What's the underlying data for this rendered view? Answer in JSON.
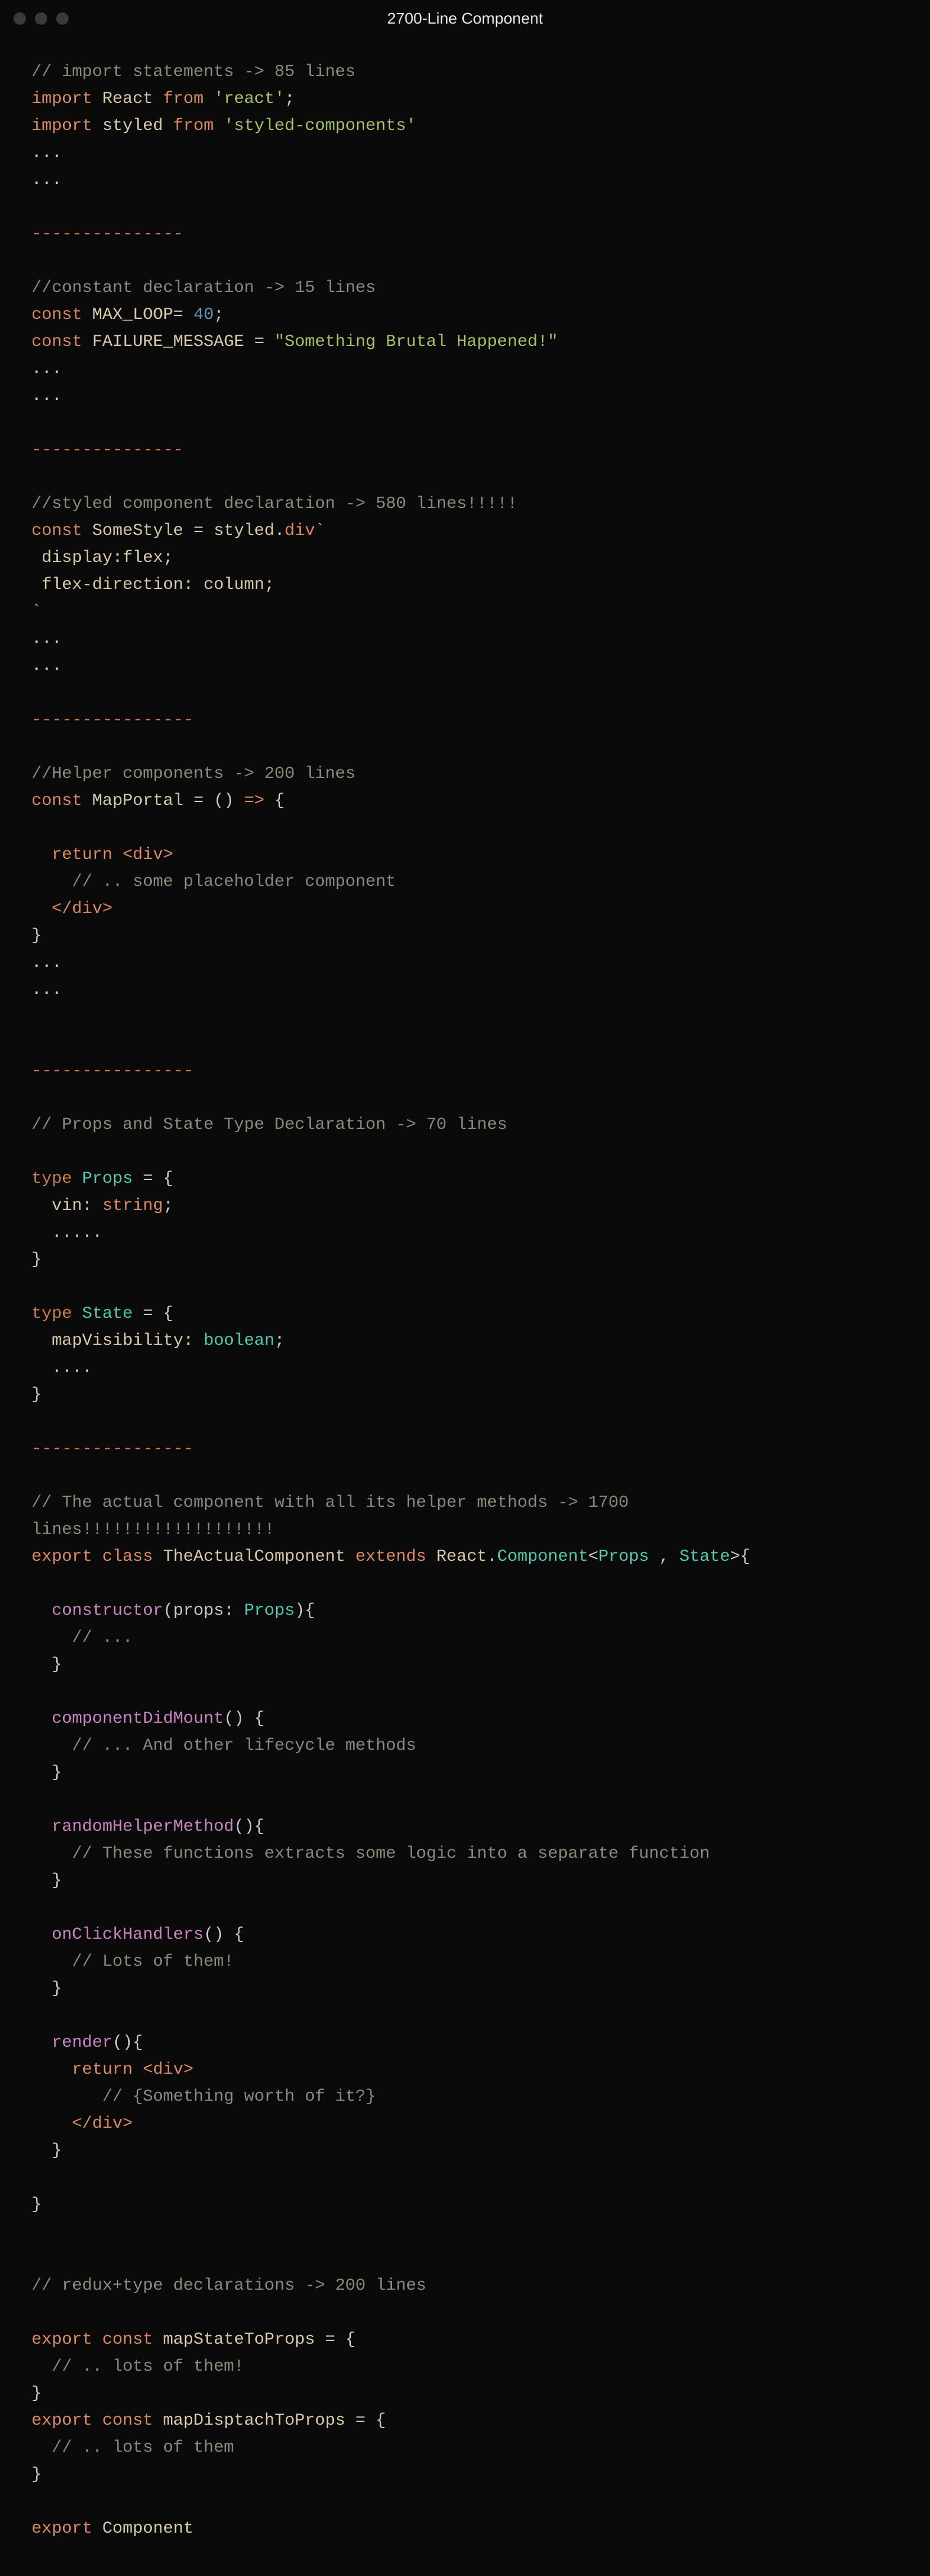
{
  "window": {
    "title": "2700-Line Component"
  },
  "code": {
    "s1_comment": "// import statements -> 85 lines",
    "s1_l1_kw1": "import",
    "s1_l1_id1": " React ",
    "s1_l1_kw2": "from",
    "s1_l1_sp": " ",
    "s1_l1_str": "'react'",
    "s1_l1_semi": ";",
    "s1_l2_kw1": "import",
    "s1_l2_id1": " styled ",
    "s1_l2_kw2": "from",
    "s1_l2_sp": " ",
    "s1_l2_str": "'styled-components'",
    "s1_d1": "...",
    "s1_d2": "...",
    "sep1": "---------------",
    "s2_comment": "//constant declaration -> 15 lines",
    "s2_l1_kw": "const",
    "s2_l1_id": " MAX_LOOP",
    "s2_l1_eq": "= ",
    "s2_l1_num": "40",
    "s2_l1_semi": ";",
    "s2_l2_kw": "const",
    "s2_l2_id": " FAILURE_MESSAGE ",
    "s2_l2_eq": "= ",
    "s2_l2_str": "\"Something Brutal Happened!\"",
    "s2_d1": "...",
    "s2_d2": "...",
    "sep2": "---------------",
    "s3_comment": "//styled component declaration -> 580 lines!!!!!",
    "s3_l1_kw": "const",
    "s3_l1_id": " SomeStyle ",
    "s3_l1_eq": "= ",
    "s3_l1_obj": "styled",
    "s3_l1_dot": ".",
    "s3_l1_m": "div",
    "s3_l1_tick": "`",
    "s3_css1": " display:flex;",
    "s3_css2": " flex-direction: column;",
    "s3_tick2": "`",
    "s3_d1": "...",
    "s3_d2": "...",
    "sep3": "----------------",
    "s4_comment": "//Helper components -> 200 lines",
    "s4_l1_kw": "const",
    "s4_l1_id": " MapPortal ",
    "s4_l1_eq": "= () ",
    "s4_l1_arrow": "=>",
    "s4_l1_brace": " {",
    "s4_ret_kw": "  return ",
    "s4_ret_open": "<div>",
    "s4_ret_c": "    // .. some placeholder component",
    "s4_ret_close": "  </div>",
    "s4_cb": "}",
    "s4_d1": "...",
    "s4_d2": "...",
    "sep4": "----------------",
    "s5_comment": "// Props and State Type Declaration -> 70 lines",
    "s5_l1_kw": "type ",
    "s5_l1_name": "Props",
    "s5_l1_rest": " = {",
    "s5_l2": "  vin: ",
    "s5_l2_t": "string",
    "s5_l2_semi": ";",
    "s5_l3": "  .....",
    "s5_l4": "}",
    "s5_l5_kw": "type ",
    "s5_l5_name": "State",
    "s5_l5_rest": " = {",
    "s5_l6": "  mapVisibility: ",
    "s5_l6_t": "boolean",
    "s5_l6_semi": ";",
    "s5_l7": "  ....",
    "s5_l8": "}",
    "sep5": "----------------",
    "s6_comment1": "// The actual component with all its helper methods -> 1700",
    "s6_comment2": "lines!!!!!!!!!!!!!!!!!!!",
    "s6_l1_kw1": "export class",
    "s6_l1_name": " TheActualComponent ",
    "s6_l1_kw2": "extends",
    "s6_l1_sp": " ",
    "s6_l1_react": "React",
    "s6_l1_dot": ".",
    "s6_l1_comp": "Component",
    "s6_l1_lt": "<",
    "s6_l1_p": "Props",
    "s6_l1_comma": " , ",
    "s6_l1_s": "State",
    "s6_l1_gt": ">{",
    "s6_ctor_name": "  constructor",
    "s6_ctor_open": "(props: ",
    "s6_ctor_t": "Props",
    "s6_ctor_close": "){",
    "s6_ctor_c": "    // ...",
    "s6_ctor_cb": "  }",
    "s6_cdm_name": "  componentDidMount",
    "s6_cdm_paren": "() {",
    "s6_cdm_c": "    // ... And other lifecycle methods",
    "s6_cdm_cb": "  }",
    "s6_rhm_name": "  randomHelperMethod",
    "s6_rhm_paren": "(){",
    "s6_rhm_c": "    // These functions extracts some logic into a separate function",
    "s6_rhm_cb": "  }",
    "s6_och_name": "  onClickHandlers",
    "s6_och_paren": "() {",
    "s6_och_c": "    // Lots of them!",
    "s6_och_cb": "  }",
    "s6_ren_name": "  render",
    "s6_ren_paren": "(){",
    "s6_ren_ret": "    return ",
    "s6_ren_open": "<div>",
    "s6_ren_c": "       // {Something worth of it?}",
    "s6_ren_close": "    </div>",
    "s6_ren_cb": "  }",
    "s6_cb": "}",
    "s7_comment": "// redux+type declarations -> 200 lines",
    "s7_l1_kw": "export const",
    "s7_l1_id": " mapStateToProps ",
    "s7_l1_rest": "= {",
    "s7_l1_c": "  // .. lots of them!",
    "s7_l1_cb": "}",
    "s7_l2_kw": "export const",
    "s7_l2_id": " mapDisptachToProps ",
    "s7_l2_rest": "= {",
    "s7_l2_c": "  // .. lots of them",
    "s7_l2_cb": "}",
    "s8_kw": "export",
    "s8_id": " Component"
  }
}
